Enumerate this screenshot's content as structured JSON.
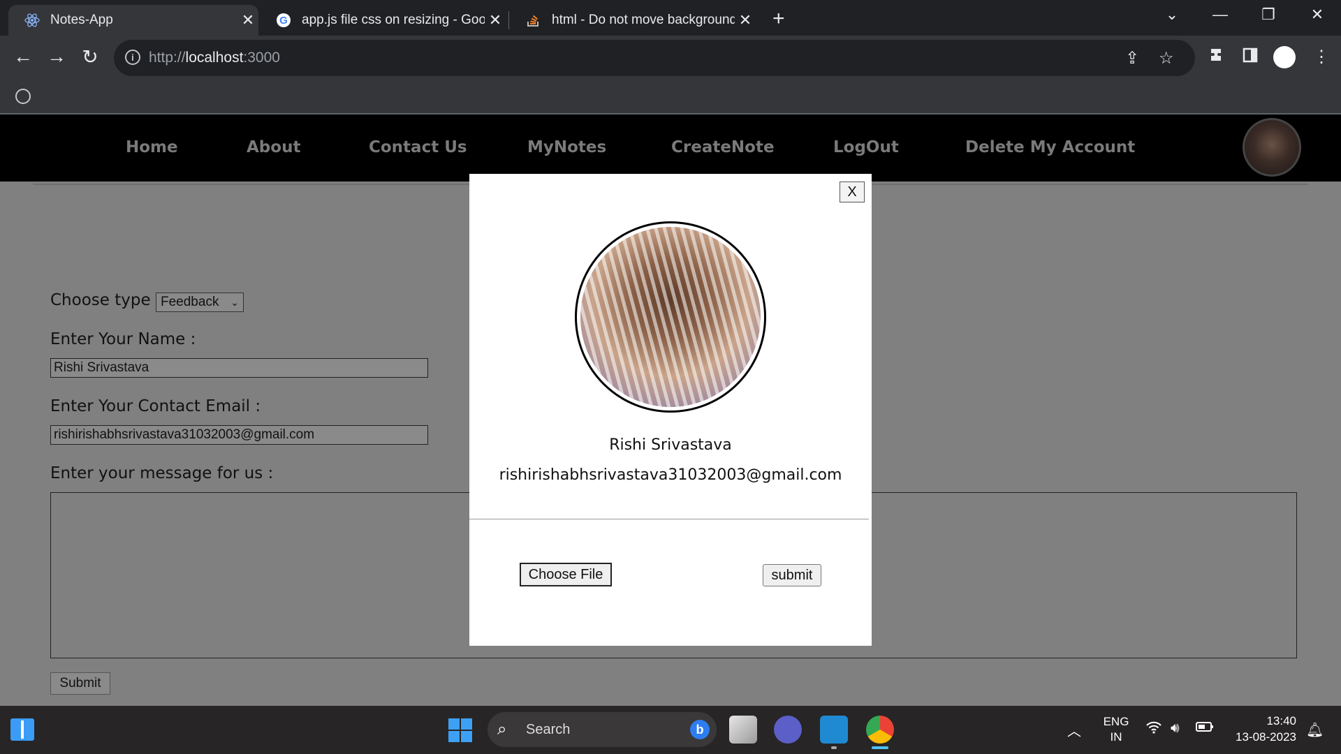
{
  "browser": {
    "tabs": [
      {
        "title": "Notes-App",
        "active": true
      },
      {
        "title": "app.js file css on resizing - Googl",
        "active": false
      },
      {
        "title": "html - Do not move background",
        "active": false
      }
    ],
    "address": {
      "scheme": "http://",
      "host": "localhost",
      "port": ":3000"
    },
    "tab_close_glyph": "✕",
    "new_tab_glyph": "+"
  },
  "app": {
    "nav": [
      "Home",
      "About",
      "Contact Us",
      "MyNotes",
      "CreateNote",
      "LogOut",
      "Delete My Account"
    ],
    "form": {
      "type_label": "Choose type :",
      "type_value": "Feedback",
      "name_label": "Enter Your Name :",
      "name_value": "Rishi Srivastava",
      "email_label": "Enter Your Contact Email :",
      "email_value": "rishirishabhsrivastava31032003@gmail.com",
      "message_label": "Enter your message for us :",
      "message_value": "",
      "submit_label": "Submit"
    },
    "modal": {
      "close_label": "X",
      "name": "Rishi Srivastava",
      "email": "rishirishabhsrivastava31032003@gmail.com",
      "choose_file_label": "Choose File",
      "submit_label": "submit"
    }
  },
  "taskbar": {
    "search_placeholder": "Search",
    "lang_line1": "ENG",
    "lang_line2": "IN",
    "time": "13:40",
    "date": "13-08-2023"
  },
  "colors": {
    "page_bg": "#808080",
    "navbar_bg": "#000000",
    "nav_text": "#7a7a7a",
    "modal_bg": "#ffffff"
  }
}
